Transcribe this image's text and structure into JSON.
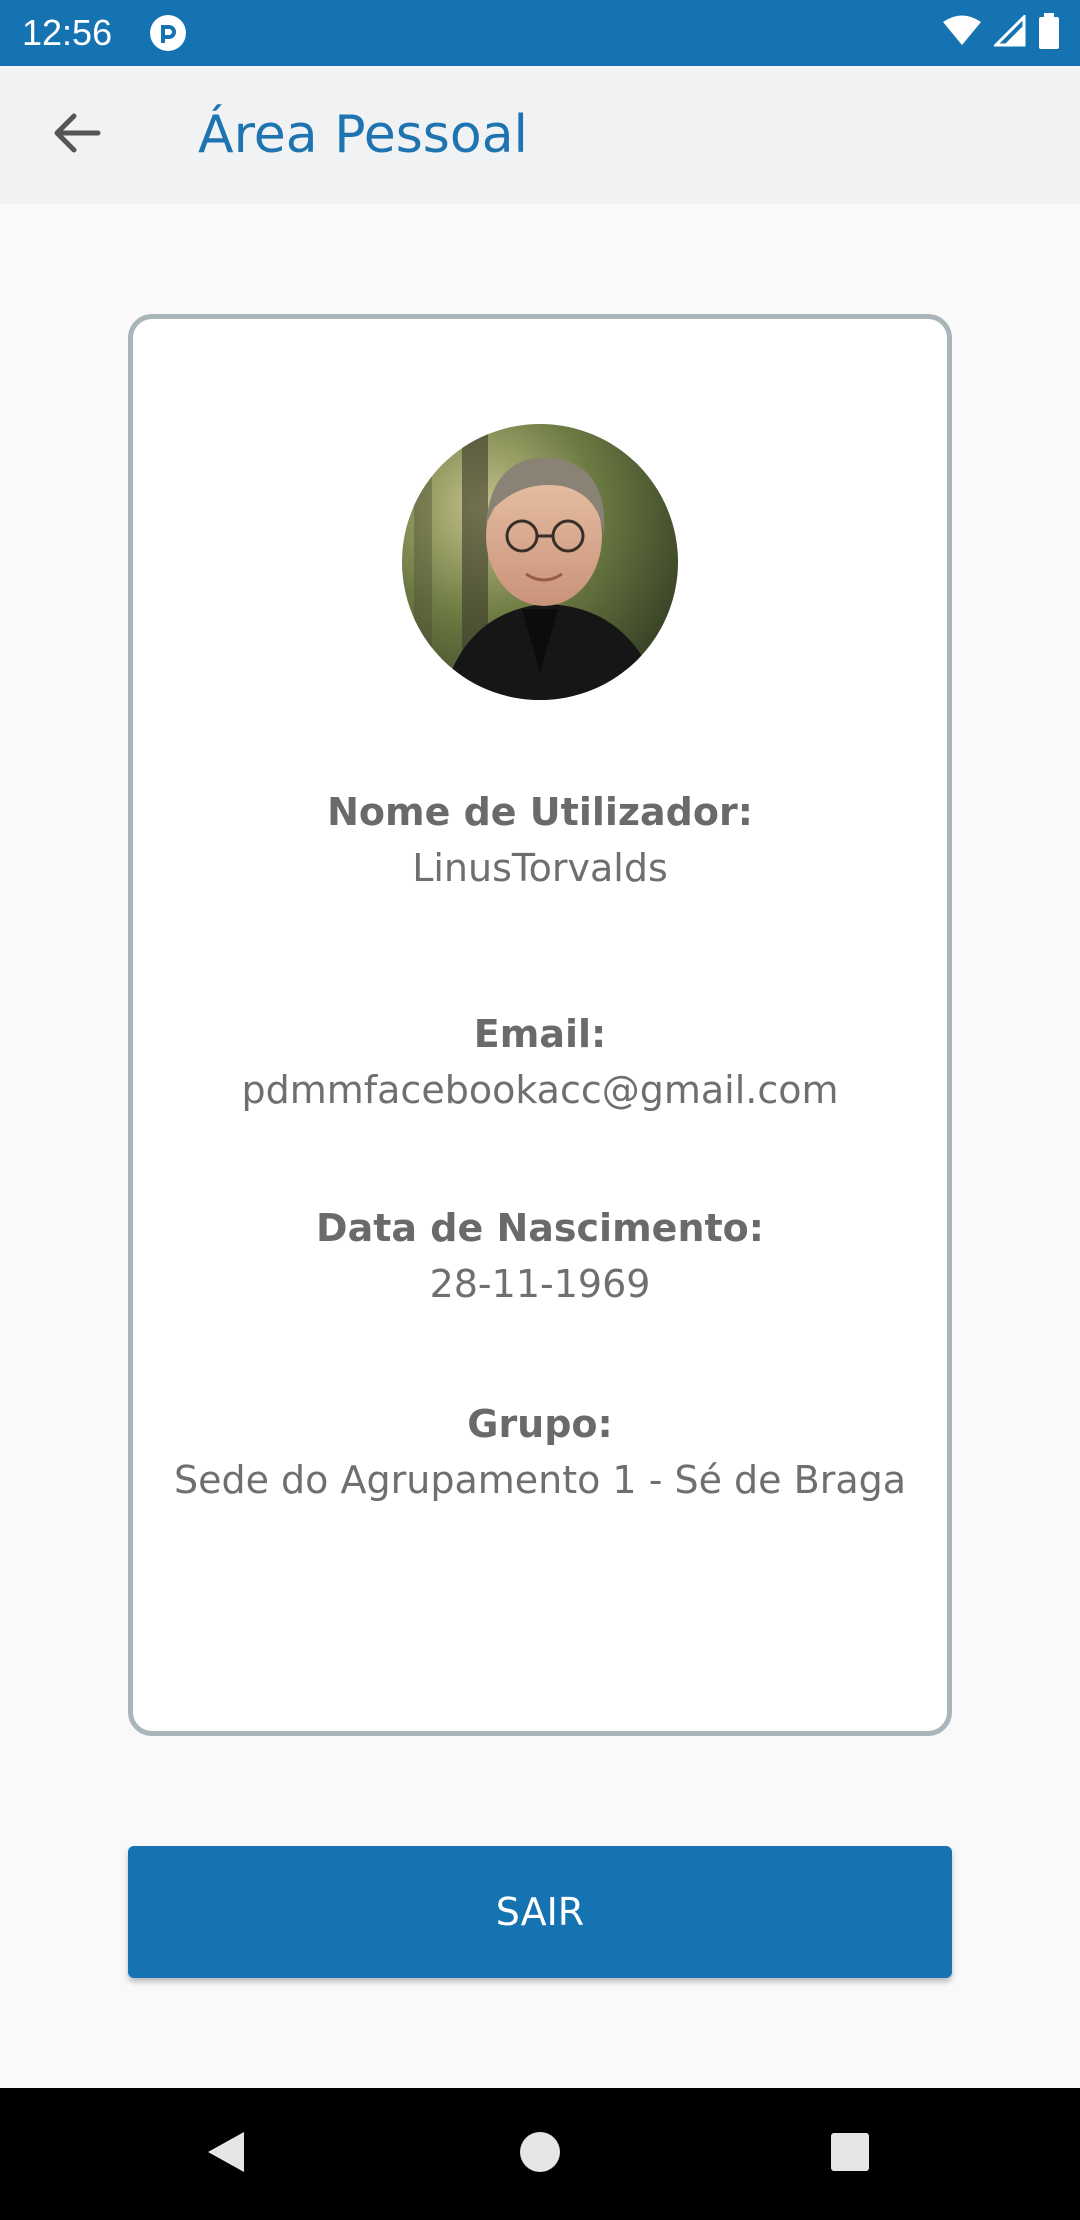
{
  "status_bar": {
    "time": "12:56",
    "background": "#1573b1",
    "icons": [
      "app-notification-icon",
      "wifi-icon",
      "cellular-signal-icon",
      "battery-icon"
    ]
  },
  "app_bar": {
    "title": "Área Pessoal",
    "back_icon": "arrow-back-icon",
    "title_color": "#1e73b1"
  },
  "profile": {
    "avatar": "profile-photo",
    "fields": [
      {
        "label": "Nome de Utilizador:",
        "value": "LinusTorvalds"
      },
      {
        "label": "Email:",
        "value": "pdmmfacebookacc@gmail.com"
      },
      {
        "label": "Data de Nascimento:",
        "value": "28-11-1969"
      },
      {
        "label": "Grupo:",
        "value": "Sede do Agrupamento 1 - Sé de Braga"
      }
    ]
  },
  "actions": {
    "logout_label": "SAIR",
    "button_color": "#1573b1"
  },
  "nav_bar": {
    "buttons": [
      "nav-back-icon",
      "nav-home-icon",
      "nav-recents-icon"
    ]
  }
}
